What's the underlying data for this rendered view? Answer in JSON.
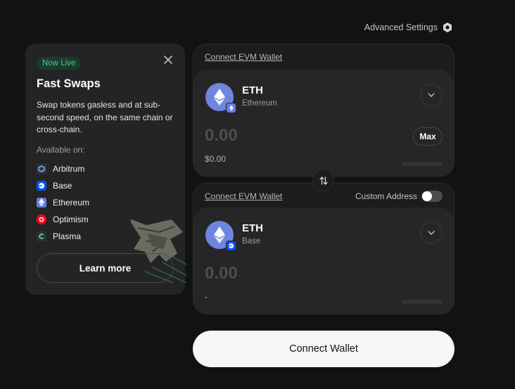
{
  "header": {
    "advanced_settings_label": "Advanced Settings",
    "settings_icon": "hexagon-gear-icon"
  },
  "promo": {
    "badge": "Now Live",
    "title": "Fast Swaps",
    "description": "Swap tokens gasless and at sub-second speed, on the same chain or cross-chain.",
    "available_label": "Available on:",
    "chains": [
      {
        "name": "Arbitrum",
        "icon": "arbitrum-icon",
        "color": "#2d374b"
      },
      {
        "name": "Base",
        "icon": "base-icon",
        "color": "#0052ff"
      },
      {
        "name": "Ethereum",
        "icon": "ethereum-icon",
        "color": "#627eea"
      },
      {
        "name": "Optimism",
        "icon": "optimism-icon",
        "color": "#ff0420"
      },
      {
        "name": "Plasma",
        "icon": "plasma-icon",
        "color": "#1f3a33"
      }
    ],
    "learn_more_label": "Learn more"
  },
  "from": {
    "connect_label": "Connect EVM Wallet",
    "token_symbol": "ETH",
    "token_chain": "Ethereum",
    "amount": "0.00",
    "max_label": "Max",
    "usd_value": "$0.00"
  },
  "to": {
    "connect_label": "Connect EVM Wallet",
    "custom_address_label": "Custom Address",
    "custom_address_enabled": false,
    "token_symbol": "ETH",
    "token_chain": "Base",
    "amount": "0.00",
    "usd_value": "-"
  },
  "footer": {
    "connect_wallet_label": "Connect Wallet"
  },
  "colors": {
    "background": "#121212",
    "panel": "#1c1c1c",
    "accent_green": "#3ecf8e",
    "eth": "#627eea"
  }
}
